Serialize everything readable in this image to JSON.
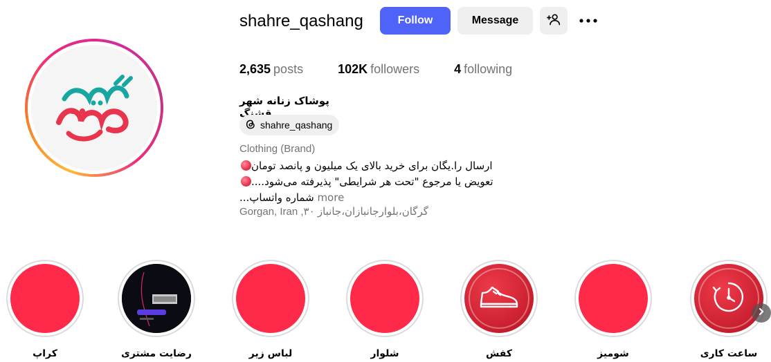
{
  "profile": {
    "username": "shahre_qashang",
    "display_name": "پوشاک زنانه شهر قشنگ",
    "threads_handle": "shahre_qashang",
    "category": "Clothing (Brand)",
    "bio_lines": [
      "ارسال را.یگان برای خرید بالای یک میلیون و پانصد تومان",
      "تعویض یا مرجوع \"تحت هر شرایطی\" پذیرفته می‌شود....",
      "شماره واتساپ..."
    ],
    "more_label": "more",
    "location": "Gorgan, Iran ,۳۰ گرگان،بلوارجانبازان،جانباز",
    "logo_text": "شهر قشنگ"
  },
  "actions": {
    "follow_label": "Follow",
    "message_label": "Message"
  },
  "stats": {
    "posts_count": "2,635",
    "posts_label": "posts",
    "followers_count": "102K",
    "followers_label": "followers",
    "following_count": "4",
    "following_label": "following"
  },
  "highlights": [
    {
      "label": "کراپ",
      "icon": "red-circle"
    },
    {
      "label": "رضایت مشتری",
      "icon": "dark-photo"
    },
    {
      "label": "لباس زیر",
      "icon": "red-circle"
    },
    {
      "label": "شلوار",
      "icon": "red-circle"
    },
    {
      "label": "کفش",
      "icon": "sneaker-icon"
    },
    {
      "label": "شومیز",
      "icon": "red-circle"
    },
    {
      "label": "ساعت کاری",
      "icon": "clock-icon"
    }
  ],
  "colors": {
    "follow_button": "#4f63f8",
    "secondary_button": "#efefef",
    "highlight_red": "#ff2a4a",
    "muted_text": "#737373"
  }
}
